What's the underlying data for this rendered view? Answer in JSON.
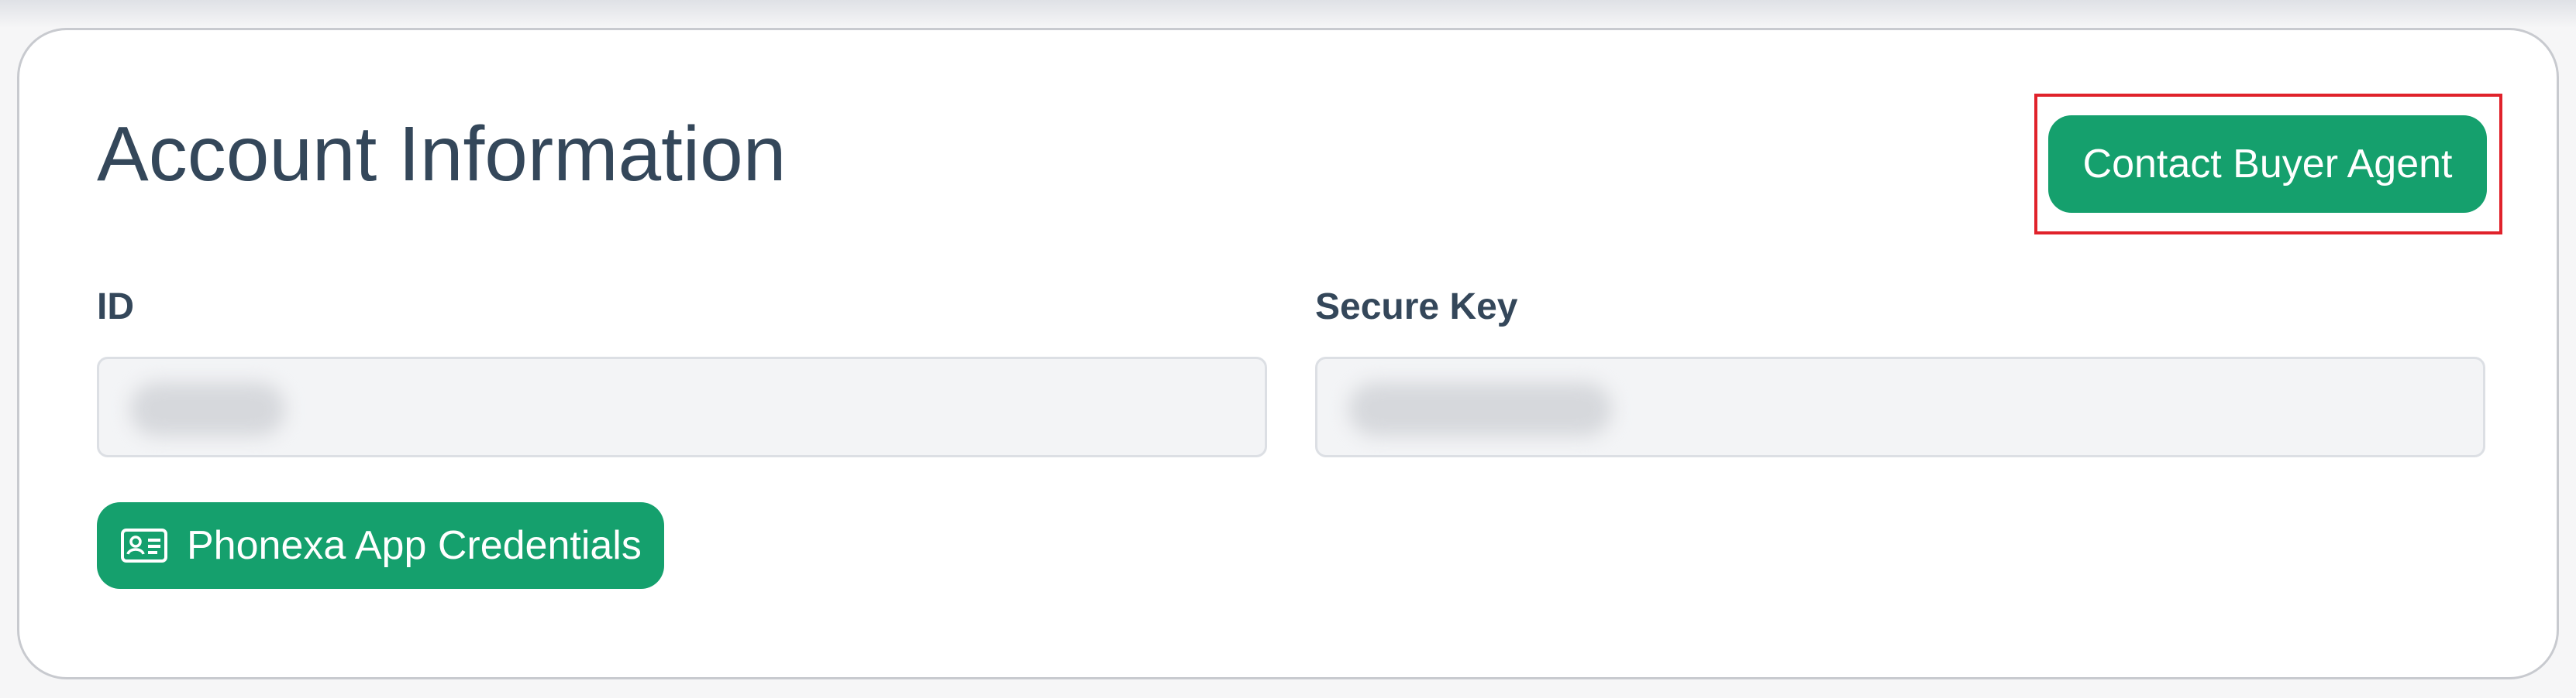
{
  "section": {
    "title": "Account Information"
  },
  "actions": {
    "contact_button_label": "Contact Buyer Agent",
    "credentials_button_label": "Phonexa App Credentials",
    "credentials_icon": "id-card-icon"
  },
  "fields": {
    "id_label": "ID",
    "id_value": "",
    "secure_key_label": "Secure Key",
    "secure_key_value": ""
  },
  "colors": {
    "accent": "#15a06d",
    "heading": "#34475a",
    "highlight": "#e0222b"
  }
}
